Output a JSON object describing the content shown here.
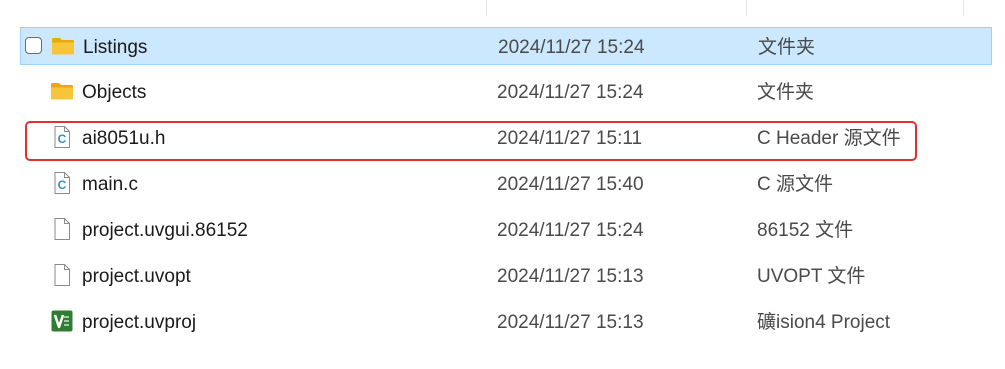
{
  "files": [
    {
      "name": "Listings",
      "date": "2024/11/27 15:24",
      "type": "文件夹",
      "icon": "folder-icon",
      "selected": true
    },
    {
      "name": "Objects",
      "date": "2024/11/27 15:24",
      "type": "文件夹",
      "icon": "folder-icon",
      "selected": false
    },
    {
      "name": "ai8051u.h",
      "date": "2024/11/27 15:11",
      "type": "C Header 源文件",
      "icon": "c-file-icon",
      "selected": false
    },
    {
      "name": "main.c",
      "date": "2024/11/27 15:40",
      "type": "C 源文件",
      "icon": "c-file-icon",
      "selected": false
    },
    {
      "name": "project.uvgui.86152",
      "date": "2024/11/27 15:24",
      "type": "86152 文件",
      "icon": "generic-file-icon",
      "selected": false
    },
    {
      "name": "project.uvopt",
      "date": "2024/11/27 15:13",
      "type": "UVOPT 文件",
      "icon": "generic-file-icon",
      "selected": false
    },
    {
      "name": "project.uvproj",
      "date": "2024/11/27 15:13",
      "type": "礦ision4 Project",
      "icon": "uvision-project-icon",
      "selected": false
    }
  ],
  "colors": {
    "selection_bg": "#cce8ff",
    "selection_border": "#99d1ff",
    "highlight_border": "#e03131",
    "folder": "#f8c53a",
    "c_icon": "#2f8fc9",
    "uvision": "#2e7d32"
  },
  "highlighted_file": "ai8051u.h"
}
